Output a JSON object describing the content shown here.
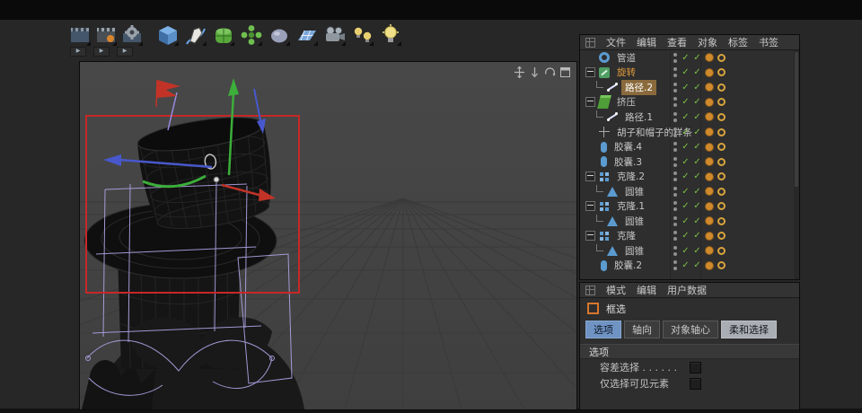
{
  "colors": {
    "selection_highlight": "#8a6a3c",
    "active_object_text": "#e09a3c",
    "check_green": "#7ac143",
    "tag_orange": "#cf8a2d",
    "marquee_red": "#c62828",
    "spline_cage_purple": "#b2a5e8",
    "axis_green": "#3cae3a",
    "axis_blue": "#4858cc",
    "axis_red": "#c23327",
    "tab_active_blue": "#6f94c4",
    "tab_pressed_gray": "#a9aeb4"
  },
  "toolbar": {
    "render_icons": [
      "render-view",
      "render-to-picture-viewer",
      "edit-render-settings"
    ],
    "create_icons": [
      "cube-primitive",
      "spline-pen",
      "subdivision-surface",
      "array",
      "deformer",
      "floor",
      "camera",
      "lights",
      "light-bulb"
    ]
  },
  "viewport": {
    "nav_icons": [
      "pan",
      "dolly",
      "orbit",
      "toggle-view"
    ]
  },
  "object_manager": {
    "menu": [
      "文件",
      "编辑",
      "查看",
      "对象",
      "标签",
      "书签"
    ],
    "rows": [
      {
        "name": "管道",
        "icon": "tube",
        "level": 0,
        "toggle": false,
        "selected": false
      },
      {
        "name": "旋转",
        "icon": "lathe",
        "level": 0,
        "toggle": true,
        "selected": false,
        "emphasis": "orange"
      },
      {
        "name": "路径.2",
        "icon": "spline",
        "level": 1,
        "toggle": false,
        "selected": true
      },
      {
        "name": "挤压",
        "icon": "extrude",
        "level": 0,
        "toggle": true,
        "selected": false
      },
      {
        "name": "路径.1",
        "icon": "spline",
        "level": 1,
        "toggle": false,
        "selected": false
      },
      {
        "name": "胡子和帽子的样条",
        "icon": "null",
        "level": 0,
        "toggle": false,
        "selected": false
      },
      {
        "name": "胶囊.4",
        "icon": "capsule",
        "level": 0,
        "toggle": false,
        "selected": false
      },
      {
        "name": "胶囊.3",
        "icon": "capsule",
        "level": 0,
        "toggle": false,
        "selected": false
      },
      {
        "name": "克隆.2",
        "icon": "cloner",
        "level": 0,
        "toggle": true,
        "selected": false
      },
      {
        "name": "圆锥",
        "icon": "cone",
        "level": 1,
        "toggle": false,
        "selected": false
      },
      {
        "name": "克隆.1",
        "icon": "cloner",
        "level": 0,
        "toggle": true,
        "selected": false
      },
      {
        "name": "圆锥",
        "icon": "cone",
        "level": 1,
        "toggle": false,
        "selected": false
      },
      {
        "name": "克隆",
        "icon": "cloner",
        "level": 0,
        "toggle": true,
        "selected": false
      },
      {
        "name": "圆锥",
        "icon": "cone",
        "level": 1,
        "toggle": false,
        "selected": false
      },
      {
        "name": "胶囊.2",
        "icon": "capsule",
        "level": 0,
        "toggle": false,
        "selected": false
      }
    ]
  },
  "attributes": {
    "menu": [
      "模式",
      "编辑",
      "用户数据"
    ],
    "tool_label": "框选",
    "tabs": [
      "选项",
      "轴向",
      "对象轴心",
      "柔和选择"
    ],
    "active_tab": "选项",
    "pressed_tab": "柔和选择",
    "section_title": "选项",
    "options": [
      {
        "label": "容差选择 . . . . . .",
        "checked": false
      },
      {
        "label": "仅选择可见元素",
        "checked": false
      }
    ]
  }
}
